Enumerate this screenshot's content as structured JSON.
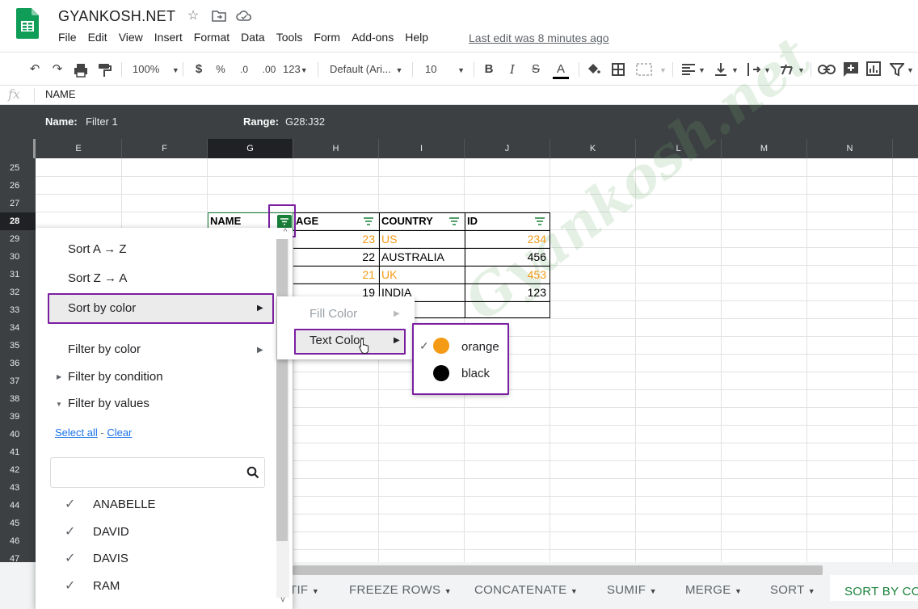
{
  "header": {
    "doc_title": "GYANKOSH.NET",
    "menu": [
      "File",
      "Edit",
      "View",
      "Insert",
      "Format",
      "Data",
      "Tools",
      "Form",
      "Add-ons",
      "Help"
    ],
    "last_edit": "Last edit was 8 minutes ago"
  },
  "toolbar": {
    "zoom": "100%",
    "currency": "$",
    "percent": "%",
    "decimal_decrease": ".0",
    "decimal_increase": ".00",
    "more_formats": "123",
    "font": "Default (Ari...",
    "font_size": "10",
    "bold": "B",
    "italic": "I",
    "strikethrough": "S",
    "text_color": "A"
  },
  "formula_bar": {
    "fx": "fx",
    "value": "NAME"
  },
  "filter_bar": {
    "name_label": "Name:",
    "name_value": "Filter 1",
    "range_label": "Range:",
    "range_value": "G28:J32"
  },
  "columns": [
    "E",
    "F",
    "G",
    "H",
    "I",
    "J",
    "K",
    "L",
    "M",
    "N"
  ],
  "active_column": "G",
  "rows": [
    "25",
    "26",
    "27",
    "28",
    "29",
    "30",
    "31",
    "32",
    "33",
    "34",
    "35",
    "36",
    "37",
    "38",
    "39",
    "40",
    "41",
    "42",
    "43",
    "44",
    "45",
    "46",
    "47"
  ],
  "active_row": "28",
  "table": {
    "headers": [
      "NAME",
      "AGE",
      "COUNTRY",
      "ID"
    ],
    "rows": [
      {
        "age": "23",
        "country": "US",
        "id": "234",
        "orange": true
      },
      {
        "age": "22",
        "country": "AUSTRALIA",
        "id": "456",
        "orange": false
      },
      {
        "age": "21",
        "country": "UK",
        "id": "453",
        "orange": true
      },
      {
        "age": "19",
        "country": "INDIA",
        "id": "123",
        "orange": false
      }
    ]
  },
  "watermark": "Gyankosh.net",
  "filter_menu": {
    "sort_az": "Sort A → Z",
    "sort_za": "Sort Z → A",
    "sort_by_color": "Sort by color",
    "filter_by_color": "Filter by color",
    "filter_by_condition": "Filter by condition",
    "filter_by_values": "Filter by values",
    "select_all": "Select all",
    "link_sep": " - ",
    "clear": "Clear",
    "search_placeholder": "",
    "values": [
      "ANABELLE",
      "DAVID",
      "DAVIS",
      "RAM"
    ]
  },
  "color_submenu": {
    "fill_color": "Fill Color",
    "text_color": "Text Color"
  },
  "text_color_submenu": [
    {
      "name": "orange",
      "color": "#f49a14",
      "checked": true
    },
    {
      "name": "black",
      "color": "#000000",
      "checked": false
    }
  ],
  "sheet_tabs": [
    "TIF",
    "FREEZE ROWS",
    "CONCATENATE",
    "SUMIF",
    "MERGE",
    "SORT",
    "SORT BY CO"
  ],
  "active_tab": "SORT BY CO",
  "colors": {
    "accent_purple": "#7b1fa2",
    "green": "#188038",
    "orange": "#f49a14"
  }
}
